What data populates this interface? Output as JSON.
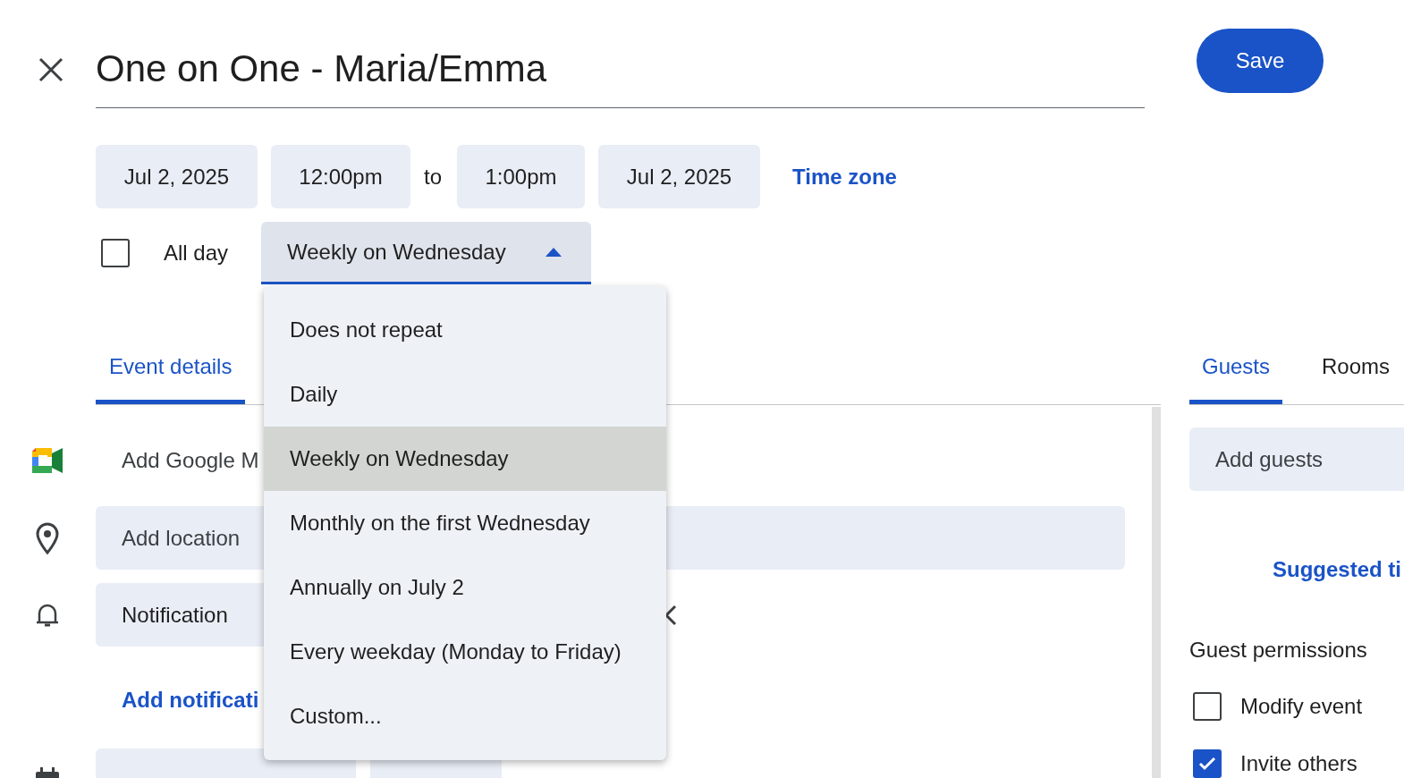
{
  "title": "One on One - Maria/Emma",
  "save": "Save",
  "start_date": "Jul 2, 2025",
  "start_time": "12:00pm",
  "to": "to",
  "end_time": "1:00pm",
  "end_date": "Jul 2, 2025",
  "time_zone": "Time zone",
  "all_day": {
    "label": "All day",
    "checked": false
  },
  "recurrence": {
    "value": "Weekly on Wednesday",
    "expanded": true,
    "options": [
      {
        "label": "Does not repeat",
        "selected": false
      },
      {
        "label": "Daily",
        "selected": false
      },
      {
        "label": "Weekly on Wednesday",
        "selected": true
      },
      {
        "label": "Monthly on the first Wednesday",
        "selected": false
      },
      {
        "label": "Annually on July 2",
        "selected": false
      },
      {
        "label": "Every weekday (Monday to Friday)",
        "selected": false
      },
      {
        "label": "Custom...",
        "selected": false
      }
    ]
  },
  "tabs_left": [
    {
      "label": "Event details",
      "selected": true
    }
  ],
  "tabs_right": [
    {
      "label": "Guests",
      "selected": true
    },
    {
      "label": "Rooms",
      "selected": false
    }
  ],
  "details": {
    "meet": "Add Google M",
    "location_placeholder": "Add location",
    "notification": "Notification",
    "add_notification": "Add notificati"
  },
  "guests": {
    "placeholder": "Add guests",
    "suggested": "Suggested ti",
    "permissions_title": "Guest permissions",
    "permissions": [
      {
        "label": "Modify event",
        "checked": false
      },
      {
        "label": "Invite others",
        "checked": true
      }
    ]
  }
}
